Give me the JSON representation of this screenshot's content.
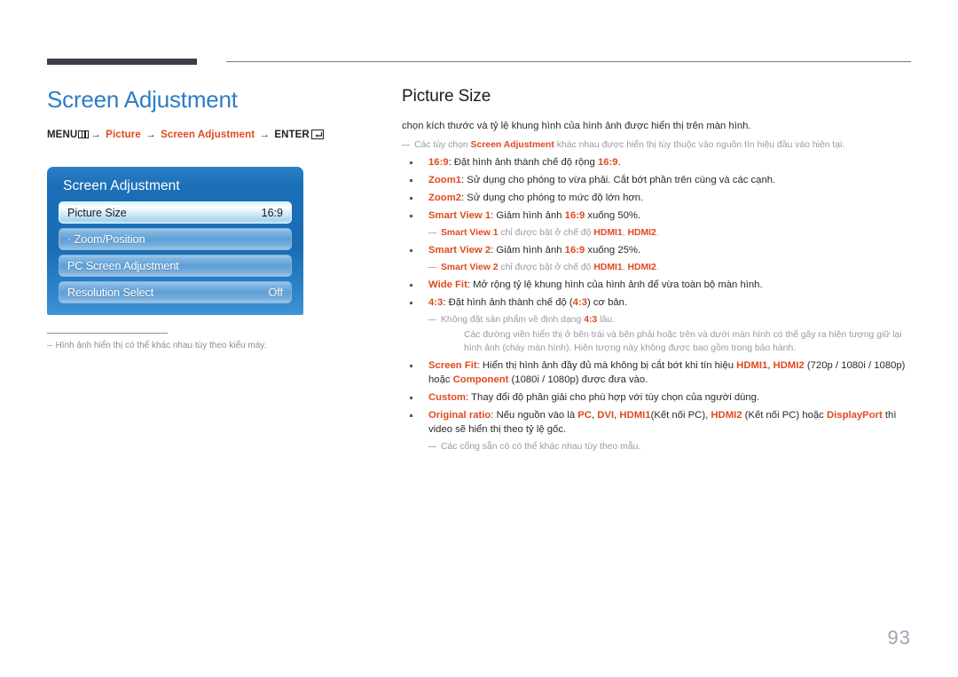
{
  "header": {
    "rule_thick": true,
    "rule_thin": true
  },
  "left": {
    "page_title": "Screen Adjustment",
    "breadcrumb": {
      "menu_label": "MENU",
      "menu_icon": "menu-bars-icon",
      "arrow": "→",
      "item1": "Picture",
      "item2": "Screen Adjustment",
      "enter_label": "ENTER",
      "enter_icon": "enter-return-icon"
    },
    "osd": {
      "title": "Screen Adjustment",
      "rows": [
        {
          "label": "Picture Size",
          "value": "16:9",
          "selected": true
        },
        {
          "label": "· Zoom/Position",
          "value": "",
          "selected": false
        },
        {
          "label": "PC Screen Adjustment",
          "value": "",
          "selected": false
        },
        {
          "label": "Resolution Select",
          "value": "Off",
          "selected": false
        }
      ]
    },
    "footnote": "Hình ảnh hiển thị có thể khác nhau tùy theo kiểu máy."
  },
  "right": {
    "section_title": "Picture Size",
    "lead": "chọn kích thước và tỷ lệ khung hình của hình ảnh được hiển thị trên màn hình.",
    "note_top_a": "Các tùy chọn ",
    "note_top_accent": "Screen Adjustment",
    "note_top_b": " khác nhau được hiển thị tùy thuộc vào nguồn tín hiệu đầu vào hiện tại.",
    "b1_key": "16:9",
    "b1_text_a": ": Đặt hình ảnh thành chế độ rộng ",
    "b1_accent2": "16:9",
    "b1_text_b": ".",
    "b2_key": "Zoom1",
    "b2_text": ": Sử dụng cho phóng to vừa phải. Cắt bớt phần trên cùng và các cạnh.",
    "b3_key": "Zoom2",
    "b3_text": ": Sử dụng cho phóng to mức độ lớn hơn.",
    "b4_key": "Smart View 1",
    "b4_text_a": ": Giảm hình ảnh ",
    "b4_accent2": "16:9",
    "b4_text_b": " xuống 50%.",
    "n4_accent": "Smart View 1",
    "n4_text": " chỉ được bật ở chế độ ",
    "n4_hdmi1": "HDMI1",
    "n4_sep": ", ",
    "n4_hdmi2": "HDMI2",
    "n4_end": ".",
    "b5_key": "Smart View 2",
    "b5_text_a": ": Giảm hình ảnh ",
    "b5_accent2": "16:9",
    "b5_text_b": " xuống 25%.",
    "n5_accent": "Smart View 2",
    "n5_text": " chỉ được bật ở chế độ ",
    "n5_hdmi1": "HDMI1",
    "n5_sep": ", ",
    "n5_hdmi2": "HDMI2",
    "n5_end": ".",
    "b6_key": "Wide Fit",
    "b6_text": ": Mở rộng tỷ lệ khung hình của hình ảnh để vừa toàn bộ màn hình.",
    "b7_key": "4:3",
    "b7_text_a": ": Đặt hình ảnh thành chế độ (",
    "b7_accent2": "4:3",
    "b7_text_b": ") cơ bản.",
    "n7_text_a": "Không đặt sản phẩm về định dạng ",
    "n7_accent": "4:3",
    "n7_text_b": " lâu.",
    "n7_cont": "Các đường viền hiển thị ở bên trái và bên phải hoặc trên và dưới màn hình có thể gây ra hiện tượng giữ lại hình ảnh (cháy màn hình). Hiện tượng này không được bao gồm trong bảo hành.",
    "b8_key": "Screen Fit",
    "b8_text_a": ": Hiển thị hình ảnh đầy đủ mà không bị cắt bớt khi tín hiệu ",
    "b8_hdmi1": "HDMI1",
    "b8_sep": ", ",
    "b8_hdmi2": "HDMI2",
    "b8_text_b": " (720p / 1080i / 1080p) hoặc ",
    "b8_comp": "Component",
    "b8_text_c": " (1080i / 1080p) được đưa vào.",
    "b9_key": "Custom",
    "b9_text": ": Thay đổi độ phân giải cho phù hợp với tùy chọn của người dùng.",
    "b10_key": "Original ratio",
    "b10_text_a": ": Nếu nguồn vào là ",
    "b10_pc": "PC",
    "b10_sep1": ", ",
    "b10_dvi": "DVI",
    "b10_sep2": ", ",
    "b10_hdmi1": "HDMI1",
    "b10_text_b": "(Kết nối PC), ",
    "b10_hdmi2": "HDMI2",
    "b10_text_c": " (Kết nối PC) hoặc ",
    "b10_dp": "DisplayPort",
    "b10_text_d": " thì video sẽ hiển thị theo tỷ lệ gốc.",
    "n10_text": "Các cổng sẵn có có thể khác nhau tùy theo mẫu."
  },
  "footer": {
    "page_number": "93"
  },
  "colors": {
    "heading_blue": "#2e7cc4",
    "accent_orange": "#e0491f",
    "note_gray": "#9a9aa3",
    "rule_dark": "#413c47",
    "osd_blue": "#1a6cb3"
  }
}
